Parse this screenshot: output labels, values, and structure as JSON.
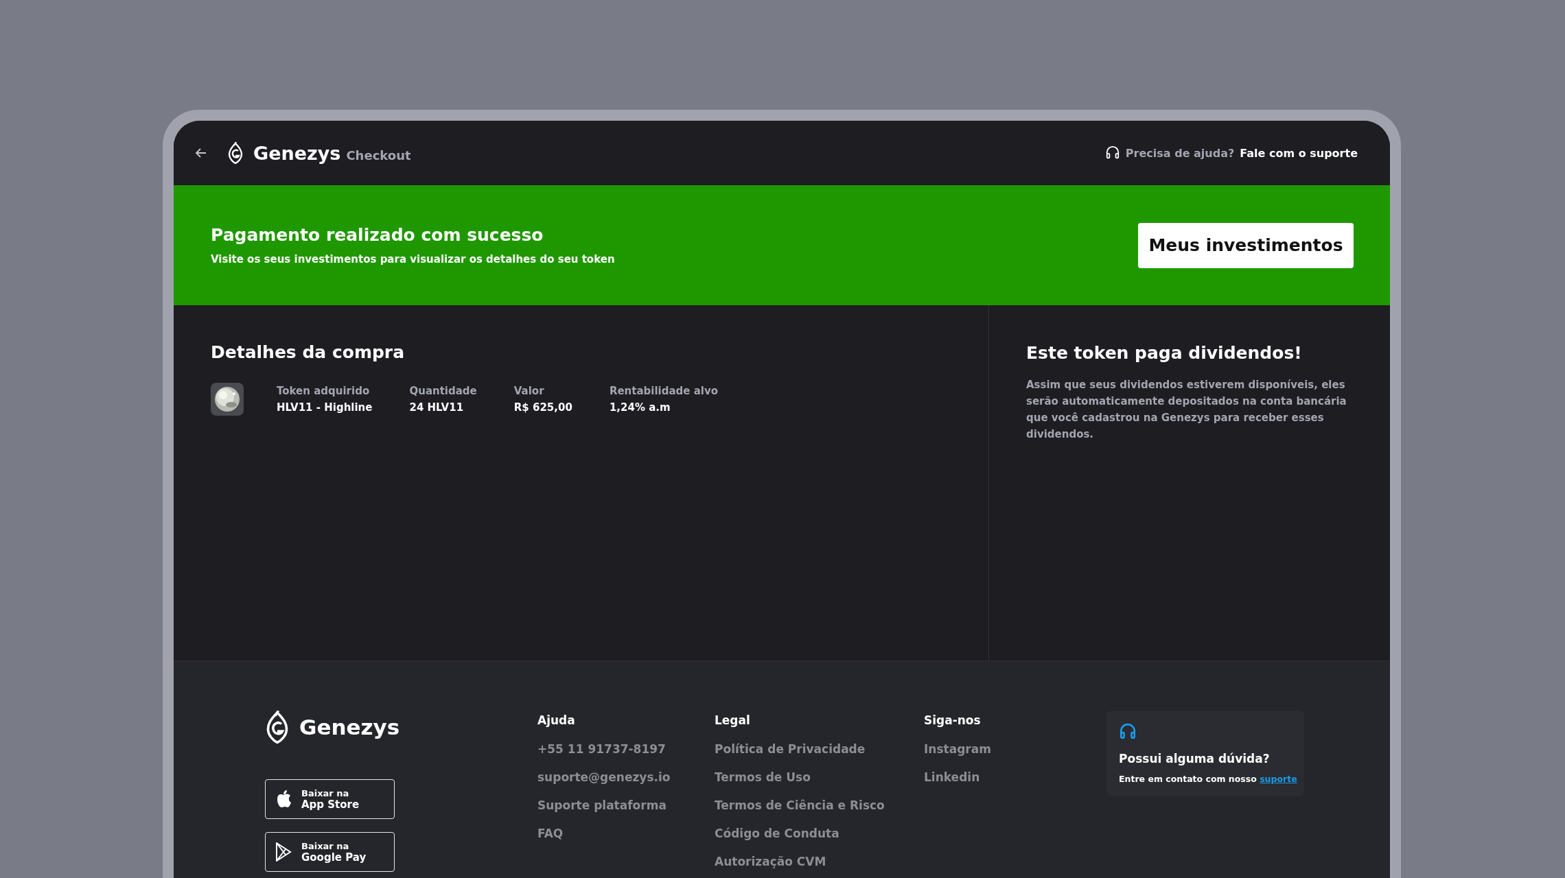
{
  "header": {
    "brand": "Genezys",
    "section": "Checkout",
    "help_prefix": "Precisa de ajuda?",
    "help_link": "Fale com o suporte"
  },
  "banner": {
    "title": "Pagamento realizado com sucesso",
    "subtitle": "Visite os seus investimentos para visualizar os detalhes do seu token",
    "button": "Meus investimentos"
  },
  "purchase": {
    "title": "Detalhes da compra",
    "fields": [
      {
        "label": "Token adquirido",
        "value": "HLV11 - Highline"
      },
      {
        "label": "Quantidade",
        "value": "24 HLV11"
      },
      {
        "label": "Valor",
        "value": "R$ 625,00"
      },
      {
        "label": "Rentabilidade alvo",
        "value": "1,24% a.m"
      }
    ]
  },
  "dividends": {
    "title": "Este token paga dividendos!",
    "text": "Assim que seus dividendos estiverem disponíveis, eles serão automaticamente depositados na conta bancária que você cadastrou na Genezys para receber esses dividendos."
  },
  "footer": {
    "brand": "Genezys",
    "app_buttons": [
      {
        "kind": "apple",
        "line1": "Baixar na",
        "line2": "App Store"
      },
      {
        "kind": "google",
        "line1": "Baixar na",
        "line2": "Google Pay"
      }
    ],
    "columns": [
      {
        "heading": "Ajuda",
        "links": [
          "+55 11 91737-8197",
          "suporte@genezys.io",
          "Suporte plataforma",
          "FAQ"
        ]
      },
      {
        "heading": "Legal",
        "links": [
          "Política de Privacidade",
          "Termos de Uso",
          "Termos de Ciência e Risco",
          "Código de Conduta",
          "Autorização CVM"
        ]
      },
      {
        "heading": "Siga-nos",
        "links": [
          "Instagram",
          "Linkedin"
        ]
      }
    ],
    "help_card": {
      "title": "Possui alguma dúvida?",
      "text": "Entre em contato com nosso",
      "link": "suporte"
    }
  }
}
